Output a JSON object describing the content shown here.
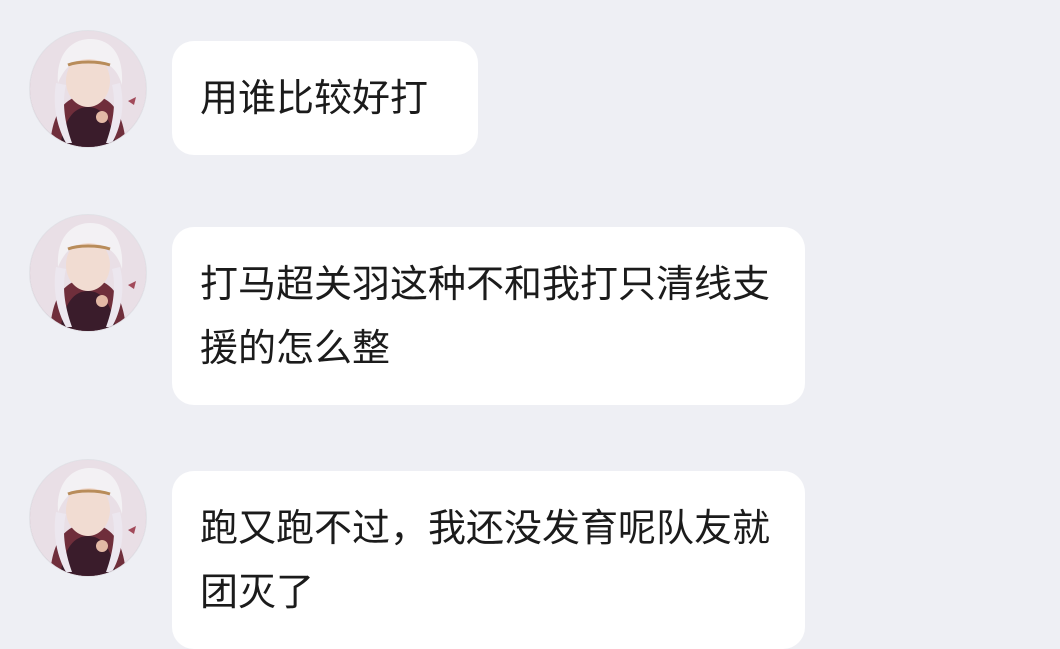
{
  "messages": [
    {
      "text": "用谁比较好打"
    },
    {
      "text": "打马超关羽这种不和我打只清线支援的怎么整"
    },
    {
      "text": "跑又跑不过，我还没发育呢队友就团灭了"
    }
  ],
  "colors": {
    "background": "#eeeff4",
    "bubble": "#ffffff",
    "text": "#1b1b1b"
  },
  "avatar_icon": "user-avatar-icon"
}
